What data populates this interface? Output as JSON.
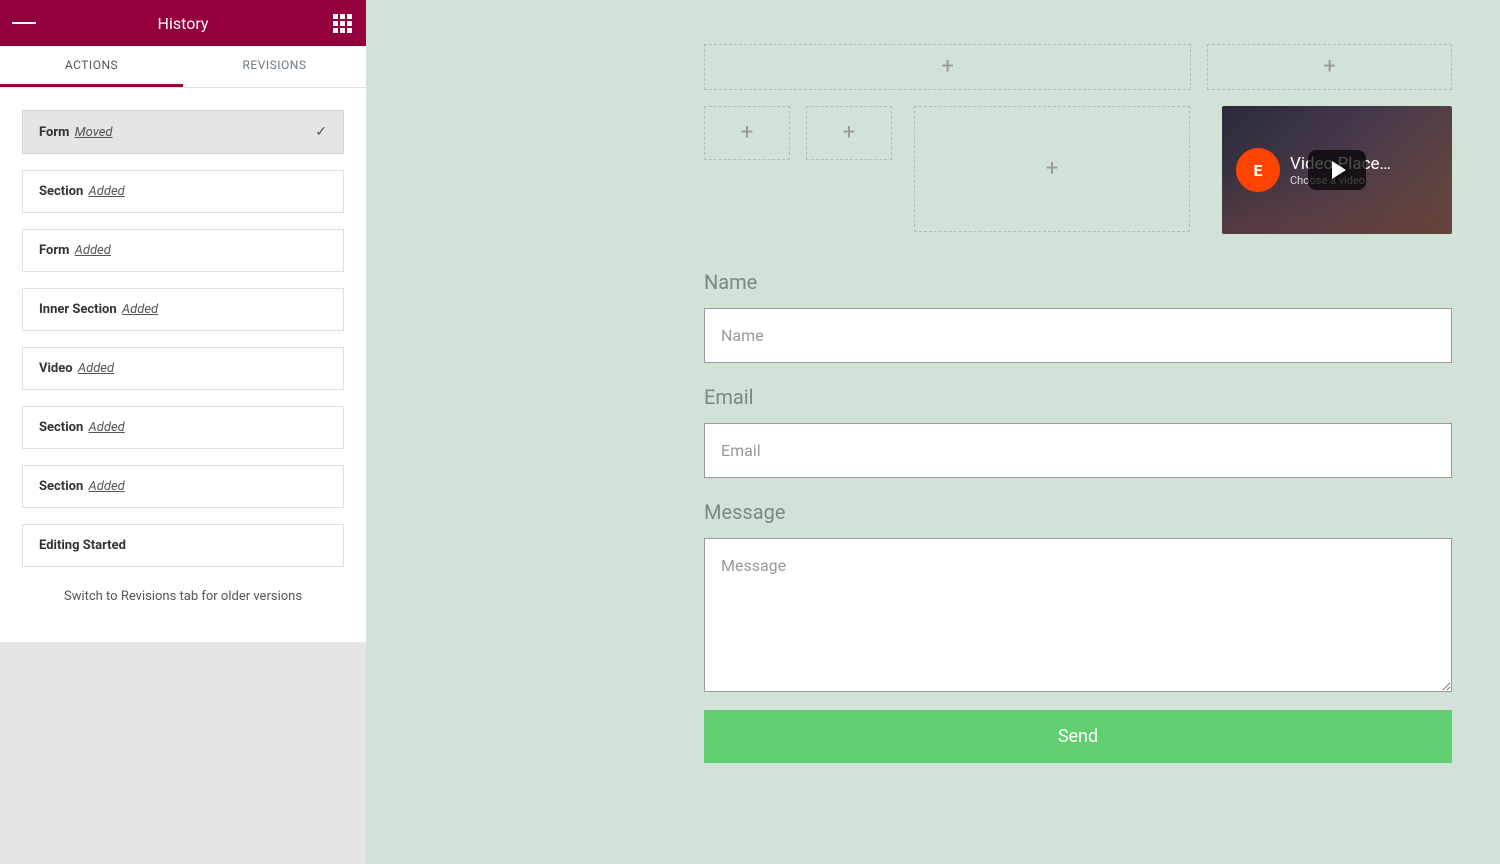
{
  "sidebar": {
    "title": "History",
    "tabs": {
      "actions": "ACTIONS",
      "revisions": "REVISIONS"
    },
    "history": [
      {
        "element": "Form",
        "action": "Moved",
        "current": true
      },
      {
        "element": "Section",
        "action": "Added"
      },
      {
        "element": "Form",
        "action": "Added"
      },
      {
        "element": "Inner Section",
        "action": "Added"
      },
      {
        "element": "Video",
        "action": "Added"
      },
      {
        "element": "Section",
        "action": "Added"
      },
      {
        "element": "Section",
        "action": "Added"
      },
      {
        "element": "Editing Started",
        "action": ""
      }
    ],
    "note": "Switch to Revisions tab for older versions"
  },
  "video": {
    "title": "Video Place…",
    "subtitle": "Choose a video"
  },
  "form": {
    "name": {
      "label": "Name",
      "placeholder": "Name"
    },
    "email": {
      "label": "Email",
      "placeholder": "Email"
    },
    "message": {
      "label": "Message",
      "placeholder": "Message"
    },
    "submit": "Send"
  }
}
